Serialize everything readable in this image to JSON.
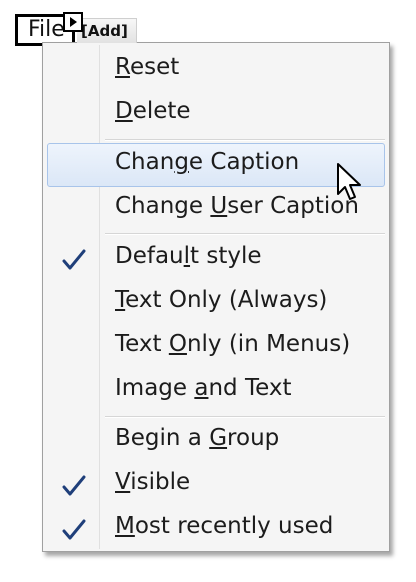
{
  "toolbar": {
    "file_label": "File",
    "add_label": "[Add]"
  },
  "menu": {
    "items": [
      {
        "pre": "",
        "key": "R",
        "post": "eset",
        "checked": false
      },
      {
        "pre": "",
        "key": "D",
        "post": "elete",
        "checked": false
      },
      {
        "pre": "Chan",
        "key": "g",
        "post": "e Caption",
        "checked": false,
        "highlighted": true
      },
      {
        "pre": "Change ",
        "key": "U",
        "post": "ser Caption",
        "checked": false
      },
      {
        "pre": "Defau",
        "key": "l",
        "post": "t style",
        "checked": true
      },
      {
        "pre": "",
        "key": "T",
        "post": "ext Only (Always)",
        "checked": false
      },
      {
        "pre": "Text ",
        "key": "O",
        "post": "nly (in Menus)",
        "checked": false
      },
      {
        "pre": "Image ",
        "key": "a",
        "post": "nd Text",
        "checked": false
      },
      {
        "pre": "Begin a ",
        "key": "G",
        "post": "roup",
        "checked": false
      },
      {
        "pre": "",
        "key": "V",
        "post": "isible",
        "checked": true
      },
      {
        "pre": "",
        "key": "M",
        "post": "ost recently used",
        "checked": true
      }
    ]
  },
  "icons": {
    "check": "checkmark-icon",
    "cursor": "mouse-pointer-icon"
  },
  "colors": {
    "check": "#1f3f7a",
    "highlight_border": "#a8c4ea"
  }
}
